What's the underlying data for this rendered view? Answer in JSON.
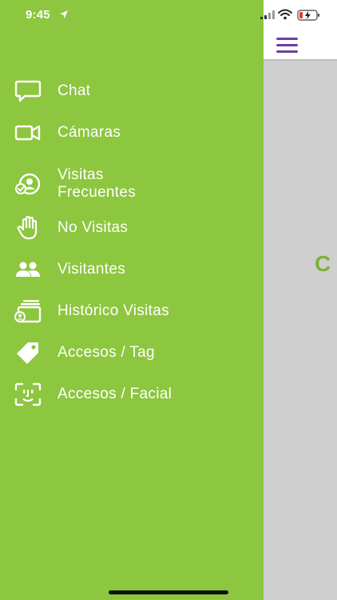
{
  "status_bar": {
    "time": "9:45"
  },
  "menu": {
    "items": [
      {
        "label": "Chat",
        "icon": "chat-bubble-icon"
      },
      {
        "label": "Cámaras",
        "icon": "video-camera-icon"
      },
      {
        "label": "Visitas\nFrecuentes",
        "icon": "frequent-visitor-icon"
      },
      {
        "label": "No Visitas",
        "icon": "hand-stop-icon"
      },
      {
        "label": "Visitantes",
        "icon": "people-icon"
      },
      {
        "label": "Histórico Visitas",
        "icon": "history-cards-icon"
      },
      {
        "label": "Accesos / Tag",
        "icon": "tag-icon"
      },
      {
        "label": "Accesos / Facial",
        "icon": "face-id-icon"
      }
    ]
  },
  "content": {
    "peek_text": "C"
  },
  "colors": {
    "drawer": "#8dc63f",
    "accent": "#6b3fa0",
    "background": "#cfcfcf"
  }
}
